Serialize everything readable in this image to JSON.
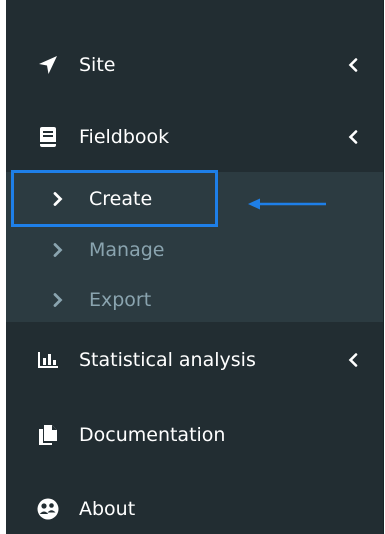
{
  "sidebar": {
    "items": [
      {
        "label": "Site",
        "icon": "location-arrow-icon",
        "has_chevron": true
      },
      {
        "label": "Fieldbook",
        "icon": "book-icon",
        "has_chevron": true
      },
      {
        "label": "Statistical analysis",
        "icon": "bar-chart-icon",
        "has_chevron": true
      },
      {
        "label": "Documentation",
        "icon": "files-icon",
        "has_chevron": false
      },
      {
        "label": "About",
        "icon": "users-icon",
        "has_chevron": false
      }
    ],
    "fieldbook_submenu": [
      {
        "label": "Create",
        "active": true
      },
      {
        "label": "Manage",
        "active": false
      },
      {
        "label": "Export",
        "active": false
      }
    ]
  },
  "annotation": {
    "highlight_color": "#1e7fe8",
    "target": "Create"
  },
  "colors": {
    "sidebar_bg": "#222d32",
    "submenu_bg": "#2c3b41",
    "text_active": "#ffffff",
    "text_inactive": "#8aa4af"
  }
}
